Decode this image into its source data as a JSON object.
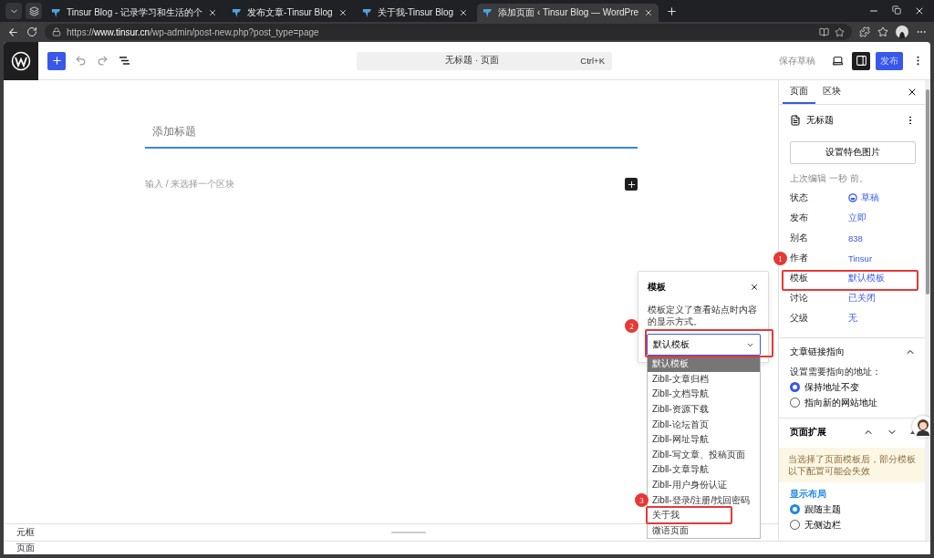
{
  "browser": {
    "tabs": [
      {
        "title": "Tinsur Blog - 记录学习和生活的个",
        "selected": false
      },
      {
        "title": "发布文章-Tinsur Blog",
        "selected": false
      },
      {
        "title": "关于我-Tinsur Blog",
        "selected": false
      },
      {
        "title": "添加页面 ‹ Tinsur Blog — WordPre",
        "selected": true
      }
    ],
    "url": "https://**www.tinsur.cn**/wp-admin/post-new.php?post_type=page"
  },
  "toolbar": {
    "command": {
      "title": "无标题 · 页面",
      "shortcut": "Ctrl+K"
    },
    "save_draft": "保存草稿",
    "publish": "发布"
  },
  "canvas": {
    "title_placeholder": "添加标题",
    "block_placeholder": "输入 / 来选择一个区块"
  },
  "sidebar": {
    "tabs": [
      {
        "label": "页面",
        "selected": true
      },
      {
        "label": "区块",
        "selected": false
      }
    ],
    "page_title": "无标题",
    "featured_image": "设置特色图片",
    "last_edited": "上次编辑 一秒 前。",
    "properties": [
      {
        "label": "状态",
        "value": "草稿",
        "kind": "status"
      },
      {
        "label": "发布",
        "value": "立即",
        "kind": "link"
      },
      {
        "label": "别名",
        "value": "838",
        "kind": "link"
      },
      {
        "label": "作者",
        "value": "Tinsur",
        "kind": "link"
      },
      {
        "label": "模板",
        "value": "默认模板",
        "kind": "link"
      },
      {
        "label": "讨论",
        "value": "已关闭",
        "kind": "link"
      },
      {
        "label": "父级",
        "value": "无",
        "kind": "link"
      }
    ],
    "redirect": {
      "title": "文章链接指向",
      "expanded": true,
      "prompt": "设置需要指向的地址：",
      "options": [
        {
          "label": "保持地址不变",
          "selected": true
        },
        {
          "label": "指向新的网站地址",
          "selected": false
        }
      ]
    },
    "extension": {
      "title": "页面扩展",
      "notice": "当选择了页面模板后，部分模板以下配置可能会失效",
      "section": "显示布局",
      "options": [
        {
          "label": "跟随主题",
          "selected": true
        },
        {
          "label": "无侧边栏",
          "selected": false
        }
      ]
    }
  },
  "popover": {
    "title": "模板",
    "description": "模板定义了查看站点时内容的显示方式。",
    "select": "默认模板",
    "options": [
      {
        "label": "默认模板",
        "selected": true
      },
      {
        "label": "Zibll-文章归档",
        "selected": false
      },
      {
        "label": "Zibll-文档导航",
        "selected": false
      },
      {
        "label": "Zibll-资源下载",
        "selected": false
      },
      {
        "label": "Zibll-论坛首页",
        "selected": false
      },
      {
        "label": "Zibll-网址导航",
        "selected": false
      },
      {
        "label": "Zibll-写文章、投稿页面",
        "selected": false
      },
      {
        "label": "Zibll-文章导航",
        "selected": false
      },
      {
        "label": "Zibll-用户身份认证",
        "selected": false
      },
      {
        "label": "Zibll-登录/注册/找回密码",
        "selected": false
      },
      {
        "label": "关于我",
        "selected": false
      },
      {
        "label": "微语页面",
        "selected": false
      }
    ]
  },
  "annotations": [
    {
      "number": "1"
    },
    {
      "number": "2"
    },
    {
      "number": "3"
    }
  ],
  "footer": {
    "metabox": "元框",
    "breadcrumb": "页面"
  }
}
